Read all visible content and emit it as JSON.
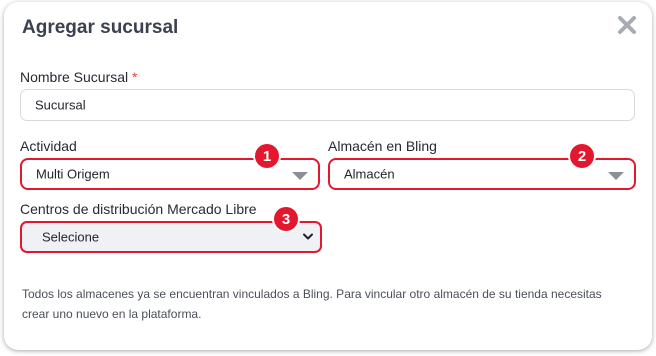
{
  "dialog": {
    "title": "Agregar sucursal",
    "close_icon": "close-icon"
  },
  "form": {
    "branch_name": {
      "label": "Nombre Sucursal",
      "required_mark": "*",
      "value": "Sucursal"
    },
    "activity": {
      "label": "Actividad",
      "value": "Multi Origem",
      "badge": "1"
    },
    "bling_warehouse": {
      "label": "Almacén en Bling",
      "value": "Almacén",
      "badge": "2"
    },
    "ml_centers": {
      "label": "Centros de distribución Mercado Libre",
      "value": "Selecione",
      "badge": "3"
    }
  },
  "info_text": "Todos los almacenes ya se encuentran vinculados a Bling. Para vincular otro almacén de su tienda necesitas crear uno nuevo en la plataforma.",
  "colors": {
    "highlight": "#e3172e",
    "title": "#3c4150",
    "select_bg": "#f0f1f5"
  }
}
